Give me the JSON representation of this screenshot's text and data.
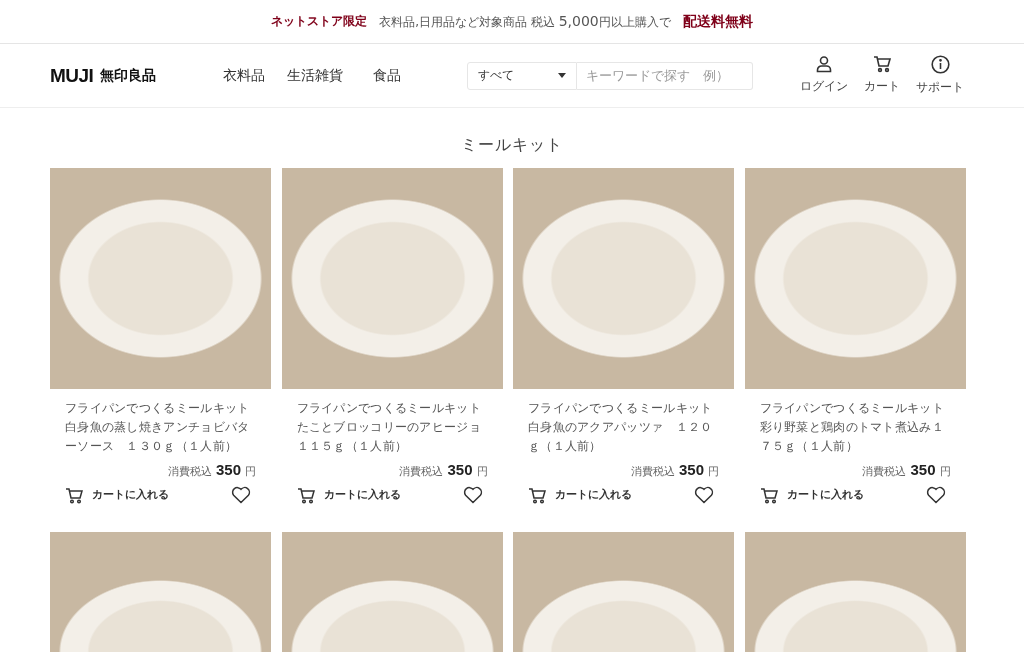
{
  "banner": {
    "tag": "ネットストア限定",
    "message": "衣料品,日用品など対象商品 税込",
    "amount": "5,000",
    "suffix": "円以上購入で",
    "highlight": "配送料無料"
  },
  "header": {
    "logo_latin": "MUJI",
    "logo_kanji": "無印良品",
    "nav": [
      "衣料品",
      "生活雑貨",
      "食品"
    ],
    "category": "すべて",
    "search_placeholder": "キーワードで探す　例）",
    "actions": [
      {
        "kind": "login",
        "label": "ログイン"
      },
      {
        "kind": "cart",
        "label": "カート"
      },
      {
        "kind": "support",
        "label": "サポート"
      }
    ]
  },
  "page_title": "ミールキット",
  "products": [
    {
      "name": "フライパンでつくるミールキット白身魚の蒸し焼きアンチョビバターソース　１３０ｇ（１人前）",
      "price_label": "消費税込",
      "price": "350",
      "currency": "円",
      "cart_label": "カートに入れる",
      "favorite": false
    },
    {
      "name": "フライパンでつくるミールキットたことブロッコリーのアヒージョ１１５ｇ（１人前）",
      "price_label": "消費税込",
      "price": "350",
      "currency": "円",
      "cart_label": "カートに入れる",
      "favorite": false
    },
    {
      "name": "フライパンでつくるミールキット白身魚のアクアパッツァ　１２０ｇ（１人前）",
      "price_label": "消費税込",
      "price": "350",
      "currency": "円",
      "cart_label": "カートに入れる",
      "favorite": false
    },
    {
      "name": "フライパンでつくるミールキット彩り野菜と鶏肉のトマト煮込み１７５ｇ（１人前）",
      "price_label": "消費税込",
      "price": "350",
      "currency": "円",
      "cart_label": "カートに入れる",
      "favorite": false
    }
  ]
}
